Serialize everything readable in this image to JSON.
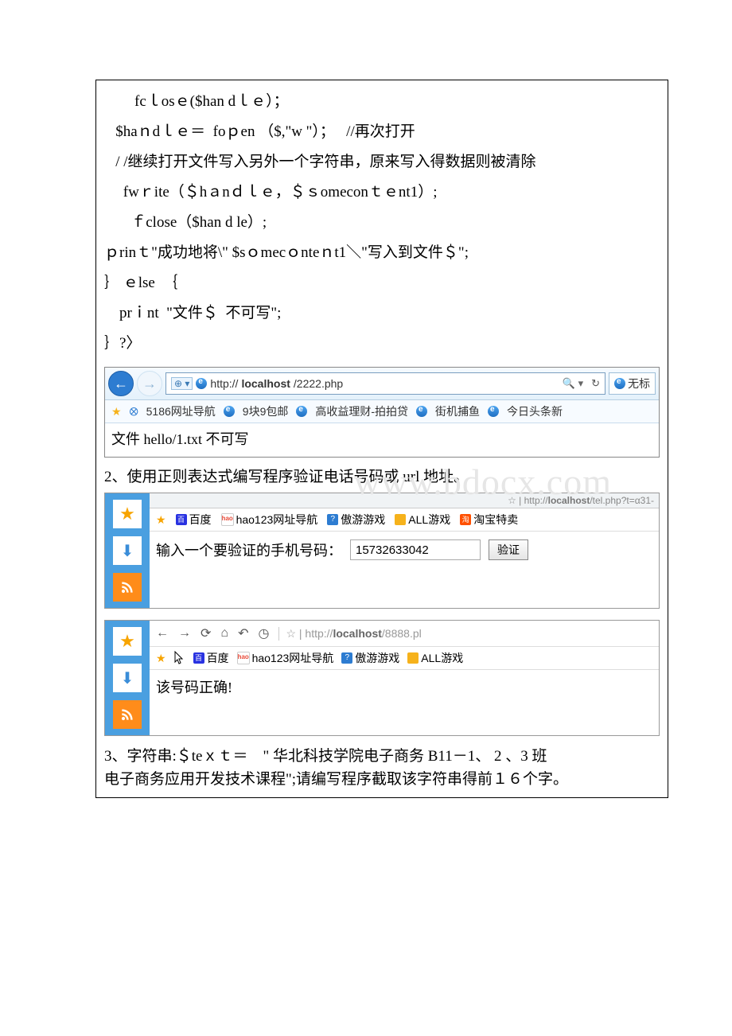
{
  "code": {
    "l1": "        fcｌosｅ($han dｌｅ）；",
    "l2": "   $haｎdｌｅ＝  foｐen （$,\"w \"）；   //再次打开",
    "l3": "   / /继续打开文件写入另外一个字符串，原来写入得数据则被清除",
    "l4": "     fwｒite（＄hａnｄｌｅ，＄ｓomeconｔｅnt1）;",
    "l5": "       ｆclose（$han d le）;",
    "l6": "ｐrinｔ\"成功地将\\\" $sｏmecｏnteｎt1＼\"写入到文件＄\";",
    "l7": "｝ ｅlse  ｛",
    "l8": "    prｉnt  \"文件＄  不可写\";",
    "l9": "｝?〉"
  },
  "ie": {
    "url_prefix": "http://",
    "url_bold": "localhost",
    "url_suffix": "/2222.php",
    "search_icon": "🔍",
    "refresh_icon": "↻",
    "tab_label": "无标",
    "bookmarks": {
      "b1": "5186网址导航",
      "b2": "9块9包邮",
      "b3": "高收益理财-拍拍贷",
      "b4": "街机捕鱼",
      "b5": "今日头条新"
    },
    "content": "文件 hello/1.txt 不可写"
  },
  "task2": {
    "text": "2、使用正则表达式编写程序验证电话号码或 url 地址。",
    "watermark": "www.bdocx.com"
  },
  "browserA": {
    "addr_label": "http://",
    "addr_bold": "localhost",
    "addr_suffix": "/tel.php?t=α31-",
    "bm": {
      "baidu": "百度",
      "hao": "hao123网址导航",
      "ao": "傲游游戏",
      "all": "ALL游戏",
      "tao": "淘宝特卖"
    },
    "prompt": "输入一个要验证的手机号码：",
    "value": "15732633042",
    "btn": "验证"
  },
  "browserB": {
    "addr_label": "http://",
    "addr_bold": "localhost",
    "addr_suffix": "/8888.pl",
    "bm": {
      "baidu": "百度",
      "hao": "hao123网址导航",
      "ao": "傲游游戏",
      "all": "ALL游戏"
    },
    "result": "该号码正确!"
  },
  "task3": {
    "line1": "    3、字符串:＄teｘｔ＝　\" 华北科技学院电子商务 B11－1、 2 、3 班",
    "line2": "电子商务应用开发技术课程\";请编写程序截取该字符串得前１６个字。"
  }
}
